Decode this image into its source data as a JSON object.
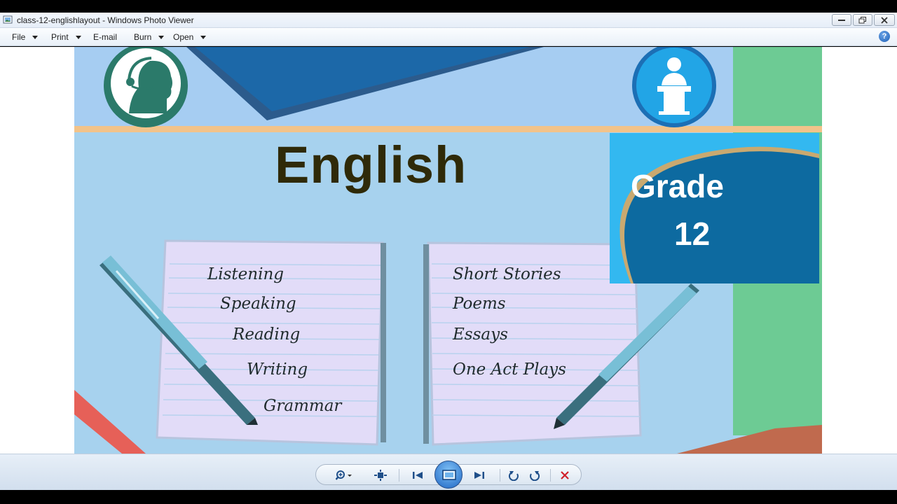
{
  "window": {
    "title": "class-12-englishlayout - Windows Photo Viewer"
  },
  "menu": {
    "file": "File",
    "print": "Print",
    "email": "E-mail",
    "burn": "Burn",
    "open": "Open"
  },
  "slide": {
    "title": "English",
    "grade_label": "Grade",
    "grade_number": "12",
    "left_topics": [
      "Listening",
      "Speaking",
      "Reading",
      "Writing",
      "Grammar"
    ],
    "right_topics": [
      "Short Stories",
      "Poems",
      "Essays",
      "One Act Plays"
    ]
  },
  "icons": {
    "app": "photo-viewer-icon",
    "help": "help-icon",
    "zoom": "zoom-icon",
    "fit": "actual-size-icon",
    "prev": "previous-icon",
    "slideshow": "slideshow-icon",
    "next": "next-icon",
    "rotate_ccw": "rotate-counterclockwise-icon",
    "rotate_cw": "rotate-clockwise-icon",
    "delete": "delete-icon"
  },
  "colors": {
    "slide_bg": "#a7d2ee",
    "grade_blue": "#0d6aa0",
    "title_text": "#2f2a08",
    "delete_red": "#d0202a"
  }
}
